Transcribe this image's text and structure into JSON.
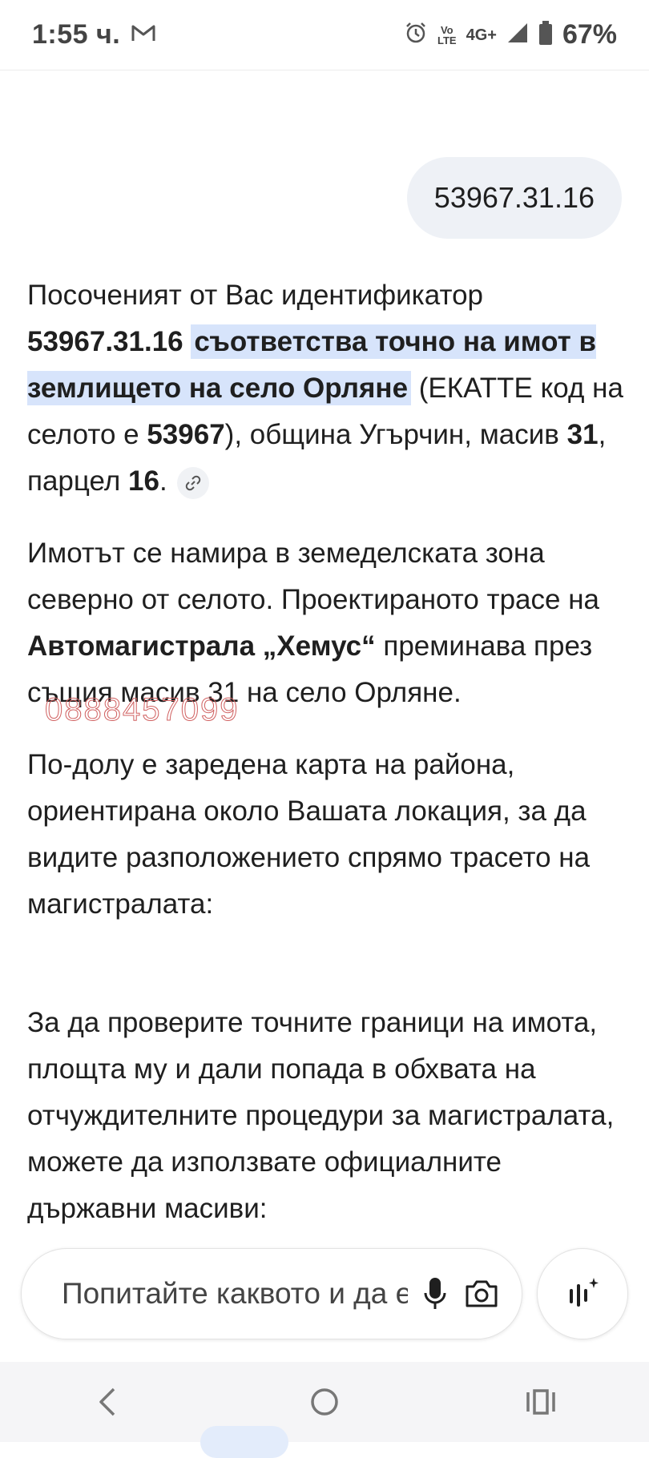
{
  "status_bar": {
    "time": "1:55 ч.",
    "network": "4G+",
    "volte_top": "Vo",
    "volte_bottom": "LTE",
    "battery": "67%"
  },
  "user_message": "53967.31.16",
  "response": {
    "p1": {
      "intro": "Посоченият от Вас идентификатор",
      "id_bold": "53967.31.16",
      "highlight": "съответства точно на имот в землището на село Орляне",
      "ekatte_pre": "(ЕКАТТЕ код на селото е",
      "ekatte_code": "53967",
      "municipality": "), община Угърчин, масив",
      "massif": "31",
      "parcel_pre": ", парцел",
      "parcel": "16",
      "end": "."
    },
    "p2": {
      "pre": "Имотът се намира в земеделската зона северно от селото. Проектираното трасе на",
      "bold": "Автомагистрала „Хемус“",
      "post": "преминава през същия масив 31 на село Орляне."
    },
    "p3": "По-долу е заредена карта на района, ориентирана около Вашата локация, за да видите разположението спрямо трасето на магистралата:",
    "p4": "За да проверите точните граници на имота, площта му и дали попада в обхвата на отчуждителните процедури за магистралата, можете да използвате официалните държавни масиви:"
  },
  "watermark": "0888457099",
  "input": {
    "placeholder": "Попитайте каквото и да е"
  },
  "colors": {
    "highlight": "#d7e4fb",
    "bubble": "#eef1f6",
    "text": "#1f1f1f"
  }
}
